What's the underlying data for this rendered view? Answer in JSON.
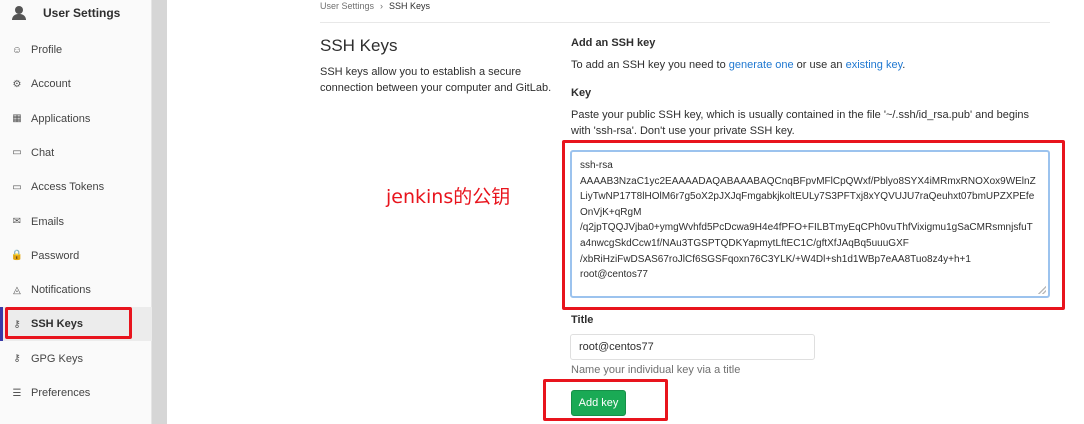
{
  "sidebar": {
    "title": "User Settings",
    "items": [
      {
        "label": "Profile",
        "icon": "profile-icon",
        "glyph": "☺"
      },
      {
        "label": "Account",
        "icon": "account-icon",
        "glyph": "⚙"
      },
      {
        "label": "Applications",
        "icon": "applications-icon",
        "glyph": "▦"
      },
      {
        "label": "Chat",
        "icon": "chat-icon",
        "glyph": "▭"
      },
      {
        "label": "Access Tokens",
        "icon": "token-icon",
        "glyph": "▭"
      },
      {
        "label": "Emails",
        "icon": "email-icon",
        "glyph": "✉"
      },
      {
        "label": "Password",
        "icon": "lock-icon",
        "glyph": "🔒"
      },
      {
        "label": "Notifications",
        "icon": "bell-icon",
        "glyph": "◬"
      },
      {
        "label": "SSH Keys",
        "icon": "key-icon",
        "glyph": "⚷"
      },
      {
        "label": "GPG Keys",
        "icon": "key-icon",
        "glyph": "⚷"
      },
      {
        "label": "Preferences",
        "icon": "sliders-icon",
        "glyph": "☰"
      }
    ],
    "active_label": "SSH Keys"
  },
  "breadcrumb": {
    "parent": "User Settings",
    "separator": "›",
    "current": "SSH Keys"
  },
  "section": {
    "title": "SSH Keys",
    "description": "SSH keys allow you to establish a secure connection between your computer and GitLab."
  },
  "form": {
    "heading": "Add an SSH key",
    "intro_prefix": "To add an SSH key you need to ",
    "intro_link1": "generate one",
    "intro_middle": " or use an ",
    "intro_link2": "existing key",
    "intro_suffix": ".",
    "key_label": "Key",
    "key_help": "Paste your public SSH key, which is usually contained in the file '~/.ssh/id_rsa.pub' and begins with 'ssh-rsa'. Don't use your private SSH key.",
    "key_lines": [
      "ssh-rsa",
      "AAAAB3NzaC1yc2EAAAADAQABAAABAQCnqBFpvMFlCpQWxf/Pblyo8SYX4iMRmxRNOXox9WElnZ",
      "LiyTwNP17T8lHOlM6r7g5oX2pJXJqFmgabkjkoltEULy7S3PFTxj8xYQVUJU7raQeuhxt07bmUPZXPEfe",
      "OnVjK+qRgM",
      "/q2jpTQQJVjba0+ymgWvhfd5PcDcwa9H4e4fPFO+FILBTmyEqCPh0vuThfVixigmu1gSaCMRsmnjsfuT",
      "a4nwcgSkdCcw1f/NAu3TGSPTQDKYapmytLftEC1C/gftXfJAqBq5uuuGXF",
      "/xbRiHziFwDSAS67roJlCf6SGSFqoxn76C3YLK/+W4Dl+sh1d1WBp7eAA8Tuo8z4y+h+1",
      "root@centos77"
    ],
    "title_label": "Title",
    "title_value": "root@centos77",
    "title_help": "Name your individual key via a title",
    "submit_label": "Add key"
  },
  "annotation": "jenkins的公钥",
  "colors": {
    "highlight": "#e8141d",
    "button": "#1aaa55",
    "link": "#1f78d1"
  }
}
